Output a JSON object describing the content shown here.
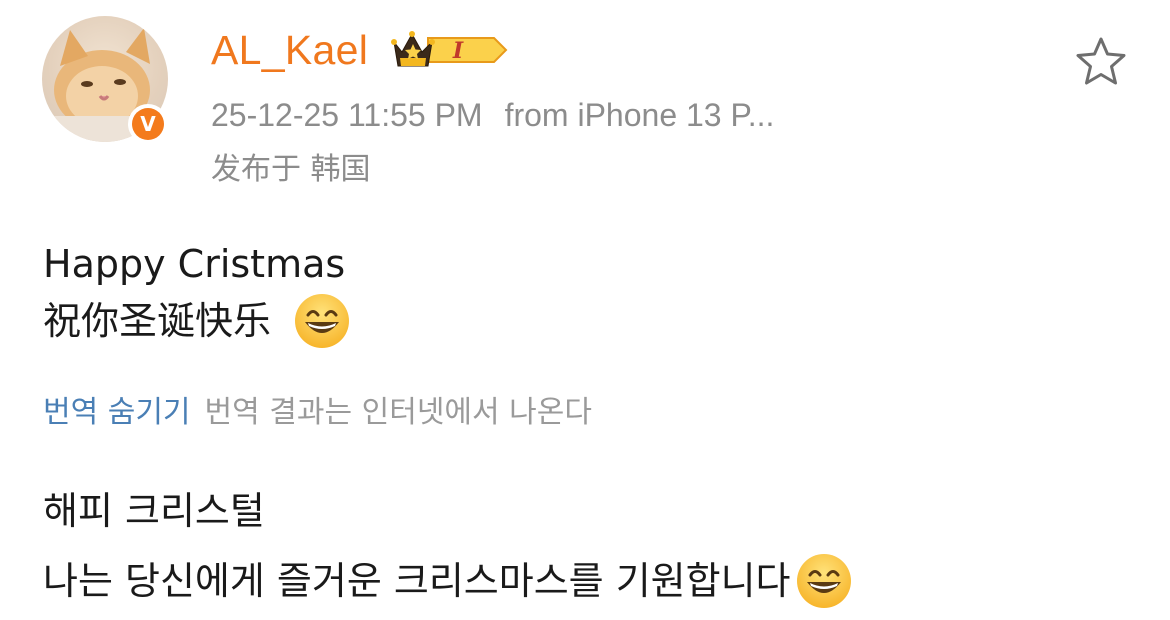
{
  "post": {
    "username": "AL_Kael",
    "vip_level": "I",
    "verified_badge": "V",
    "timestamp": "25-12-25 11:55 PM",
    "source": "from iPhone 13 P...",
    "location": "发布于 韩国",
    "text_line1": "Happy Cristmas",
    "text_line2": "祝你圣诞快乐",
    "emoji": "grinning-face-with-smiling-eyes",
    "favorite_icon": "star-outline-icon"
  },
  "translation": {
    "hide_label": "번역 숨기기",
    "note": "번역 결과는 인터넷에서 나온다",
    "line1": "해피 크리스털",
    "line2": "나는 당신에게 즐거운 크리스마스를 기원합니다"
  },
  "colors": {
    "username": "#f0781e",
    "meta": "#8c8c8c",
    "link": "#4a7fb5",
    "verified": "#f47b1c"
  }
}
